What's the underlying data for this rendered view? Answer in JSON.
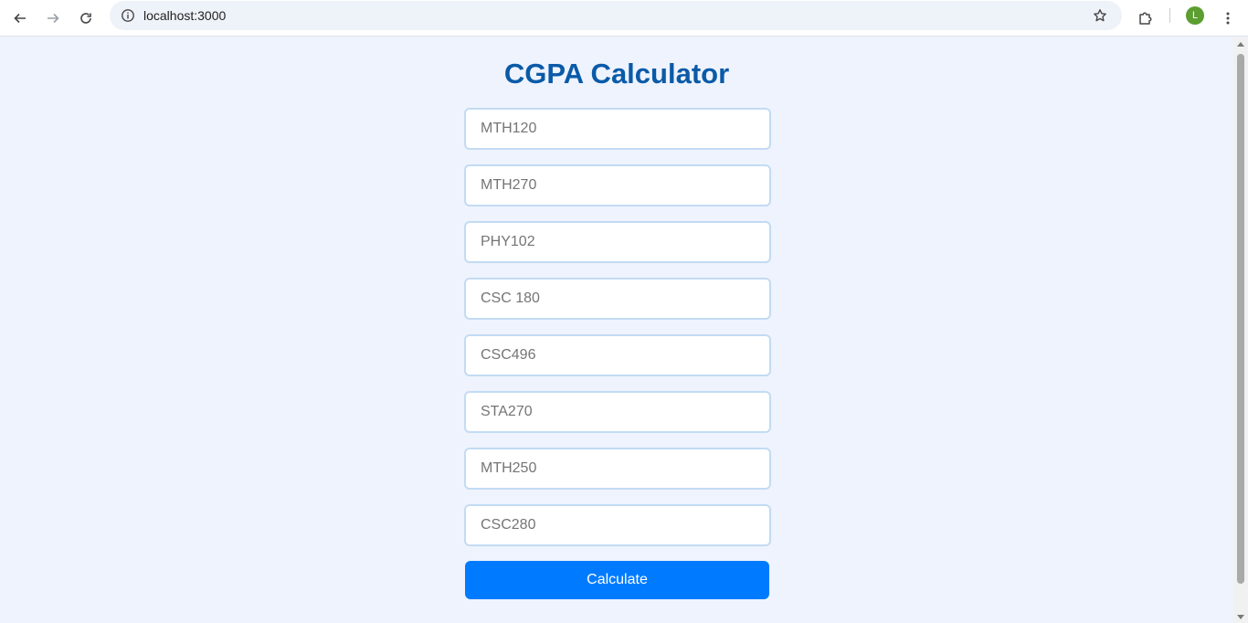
{
  "browser": {
    "url": "localhost:3000",
    "profile_initial": "L"
  },
  "page": {
    "title": "CGPA Calculator",
    "courses": [
      {
        "placeholder": "MTH120"
      },
      {
        "placeholder": "MTH270"
      },
      {
        "placeholder": "PHY102"
      },
      {
        "placeholder": "CSC 180"
      },
      {
        "placeholder": "CSC496"
      },
      {
        "placeholder": "STA270"
      },
      {
        "placeholder": "MTH250"
      },
      {
        "placeholder": "CSC280"
      }
    ],
    "calculate_label": "Calculate"
  },
  "colors": {
    "title": "#0a5aa8",
    "button": "#007bff",
    "background": "#eef3fd",
    "avatar": "#5c9e31"
  }
}
